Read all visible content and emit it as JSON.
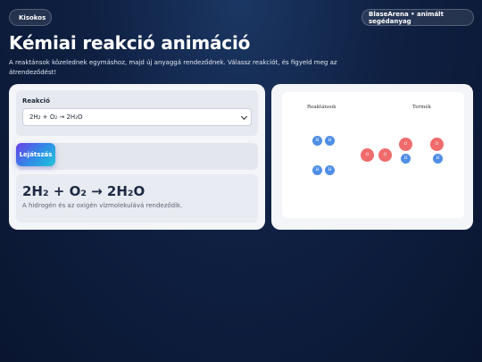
{
  "header": {
    "brand": "Kisokos",
    "arena": "BlaseArena • animált segédanyag",
    "title": "Kémiai reakció animáció",
    "lead": "A reaktánsok közelednek egymáshoz, majd új anyaggá rendeződnek. Válassz reakciót, és figyeld meg az átrendeződést!"
  },
  "controls": {
    "reaction_label": "Reakció",
    "reaction_value": "2H₂ + O₂ → 2H₂O",
    "play_label": "Lejátszás"
  },
  "equation": {
    "formula": "2H₂ + O₂ → 2H₂O",
    "description": "A hidrogén és az oxigén vízmolekulává rendeződik."
  },
  "stage": {
    "reactants_title": "Reaktánsok",
    "products_title": "Termék",
    "h_symbol": "H",
    "o_symbol": "O"
  },
  "colors": {
    "hydrogen": "#4f8ee6",
    "oxygen": "#f06b6b",
    "button_gradient": [
      "#6a3fe8",
      "#2e8fe6",
      "#22c7d8"
    ]
  }
}
